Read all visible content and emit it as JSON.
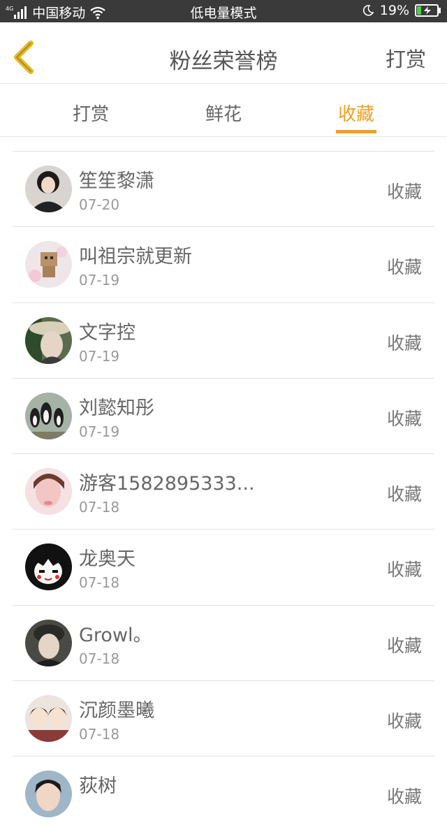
{
  "status_bar": {
    "network": "4G",
    "carrier": "中国移动",
    "mode": "低电量模式",
    "battery": "19%"
  },
  "header": {
    "title": "粉丝荣誉榜",
    "right_action": "打赏"
  },
  "tabs": [
    {
      "label": "打赏",
      "active": false
    },
    {
      "label": "鲜花",
      "active": false
    },
    {
      "label": "收藏",
      "active": true
    }
  ],
  "accent_color": "#f0a024",
  "fans": [
    {
      "name": "笙笙黎潇",
      "date": "07-20",
      "action": "收藏"
    },
    {
      "name": "叫祖宗就更新",
      "date": "07-19",
      "action": "收藏"
    },
    {
      "name": "文字控",
      "date": "07-19",
      "action": "收藏"
    },
    {
      "name": "刘懿知彤",
      "date": "07-19",
      "action": "收藏"
    },
    {
      "name": "游客1582895333...",
      "date": "07-18",
      "action": "收藏"
    },
    {
      "name": "龙奥天",
      "date": "07-18",
      "action": "收藏"
    },
    {
      "name": "Growl。",
      "date": "07-18",
      "action": "收藏"
    },
    {
      "name": "沉颜墨曦",
      "date": "07-18",
      "action": "收藏"
    },
    {
      "name": "荻树",
      "date": "",
      "action": "收藏"
    }
  ]
}
